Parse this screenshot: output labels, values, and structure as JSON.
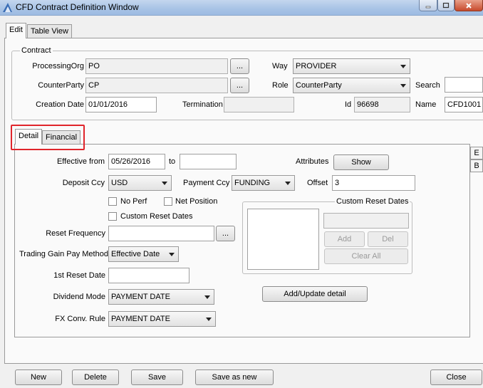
{
  "window": {
    "title": "CFD Contract Definition Window"
  },
  "top_tabs": [
    "Edit",
    "Table View"
  ],
  "contract": {
    "group_title": "Contract",
    "processing_org_label": "ProcessingOrg",
    "processing_org_value": "PO",
    "counterparty_label": "CounterParty",
    "counterparty_value": "CP",
    "creation_date_label": "Creation Date",
    "creation_date_value": "01/01/2016",
    "termination_label": "Termination",
    "termination_value": "",
    "way_label": "Way",
    "way_value": "PROVIDER",
    "role_label": "Role",
    "role_value": "CounterParty",
    "search_label": "Search",
    "search_value": "",
    "id_label": "Id",
    "id_value": "96698",
    "name_label": "Name",
    "name_value": "CFD1001",
    "ellipsis": "..."
  },
  "inner_tabs": [
    "Detail",
    "Financial"
  ],
  "side_tabs": [
    "E",
    "B"
  ],
  "detail": {
    "effective_from_label": "Effective from",
    "effective_from_value": "05/26/2016",
    "to_label": "to",
    "to_value": "",
    "attributes_label": "Attributes",
    "show_button": "Show",
    "deposit_ccy_label": "Deposit Ccy",
    "deposit_ccy_value": "USD",
    "payment_ccy_label": "Payment Ccy",
    "payment_ccy_value": "FUNDING",
    "offset_label": "Offset",
    "offset_value": "3",
    "no_perf_label": "No Perf",
    "net_position_label": "Net Position",
    "custom_reset_dates_label": "Custom Reset Dates",
    "reset_frequency_label": "Reset Frequency",
    "reset_frequency_value": "",
    "ellipsis": "...",
    "trading_gain_label": "Trading Gain Pay Method",
    "trading_gain_value": "Effective Date",
    "first_reset_date_label": "1st Reset Date",
    "first_reset_date_value": "",
    "dividend_mode_label": "Dividend Mode",
    "dividend_mode_value": "PAYMENT DATE",
    "fx_conv_rule_label": "FX Conv. Rule",
    "fx_conv_rule_value": "PAYMENT DATE",
    "custom_reset_group_title": "Custom Reset Dates",
    "add_button": "Add",
    "del_button": "Del",
    "clear_all_button": "Clear All",
    "add_update_button": "Add/Update detail"
  },
  "footer": {
    "new_button": "New",
    "delete_button": "Delete",
    "save_button": "Save",
    "save_as_new_button": "Save as new",
    "close_button": "Close"
  },
  "colors": {
    "highlight": "#e0252b",
    "titlebar": "#a9c4e6"
  }
}
